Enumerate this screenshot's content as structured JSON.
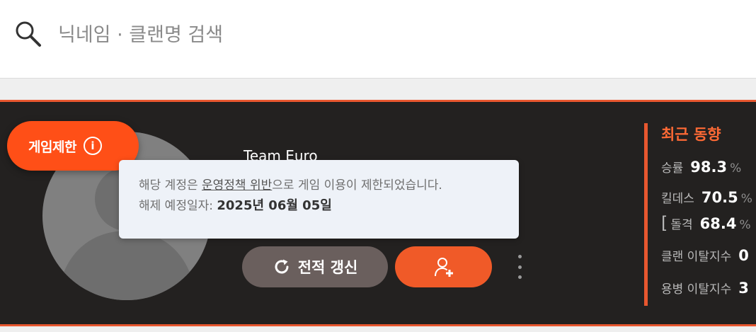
{
  "search": {
    "placeholder": "닉네임 · 클랜명 검색"
  },
  "profile": {
    "badge_label": "게임제한",
    "info_icon": "info-icon",
    "player_name": "Team Euro",
    "restriction_tooltip": {
      "line1_before": "해당 계정은 ",
      "line1_link": "운영정책 위반",
      "line1_after": "으로 게임 이용이 제한되었습니다.",
      "line2_label": "해제 예정일자: ",
      "line2_date": "2025년 06월 05일"
    },
    "refresh_button_label": "전적 갱신",
    "refresh_icon": "refresh-icon",
    "add_friend_icon": "add-friend-icon",
    "more_icon": "more-vertical-icon"
  },
  "recent_trend": {
    "title": "최근 동향",
    "win_rate": {
      "label": "승률",
      "value": "98.3",
      "unit": "%"
    },
    "kill_death": {
      "label": "킬데스",
      "value": "70.5",
      "unit": "%"
    },
    "assault": {
      "bracket": "[",
      "label": "돌격",
      "value": "68.4",
      "unit": "%"
    },
    "clan_leave": {
      "label": "클랜 이탈지수",
      "value": "0"
    },
    "merc_leave": {
      "label": "용병 이탈지수",
      "value": "3"
    }
  },
  "colors": {
    "accent": "#e8572f",
    "badge": "#ff4f17",
    "card_bg": "#232120"
  }
}
